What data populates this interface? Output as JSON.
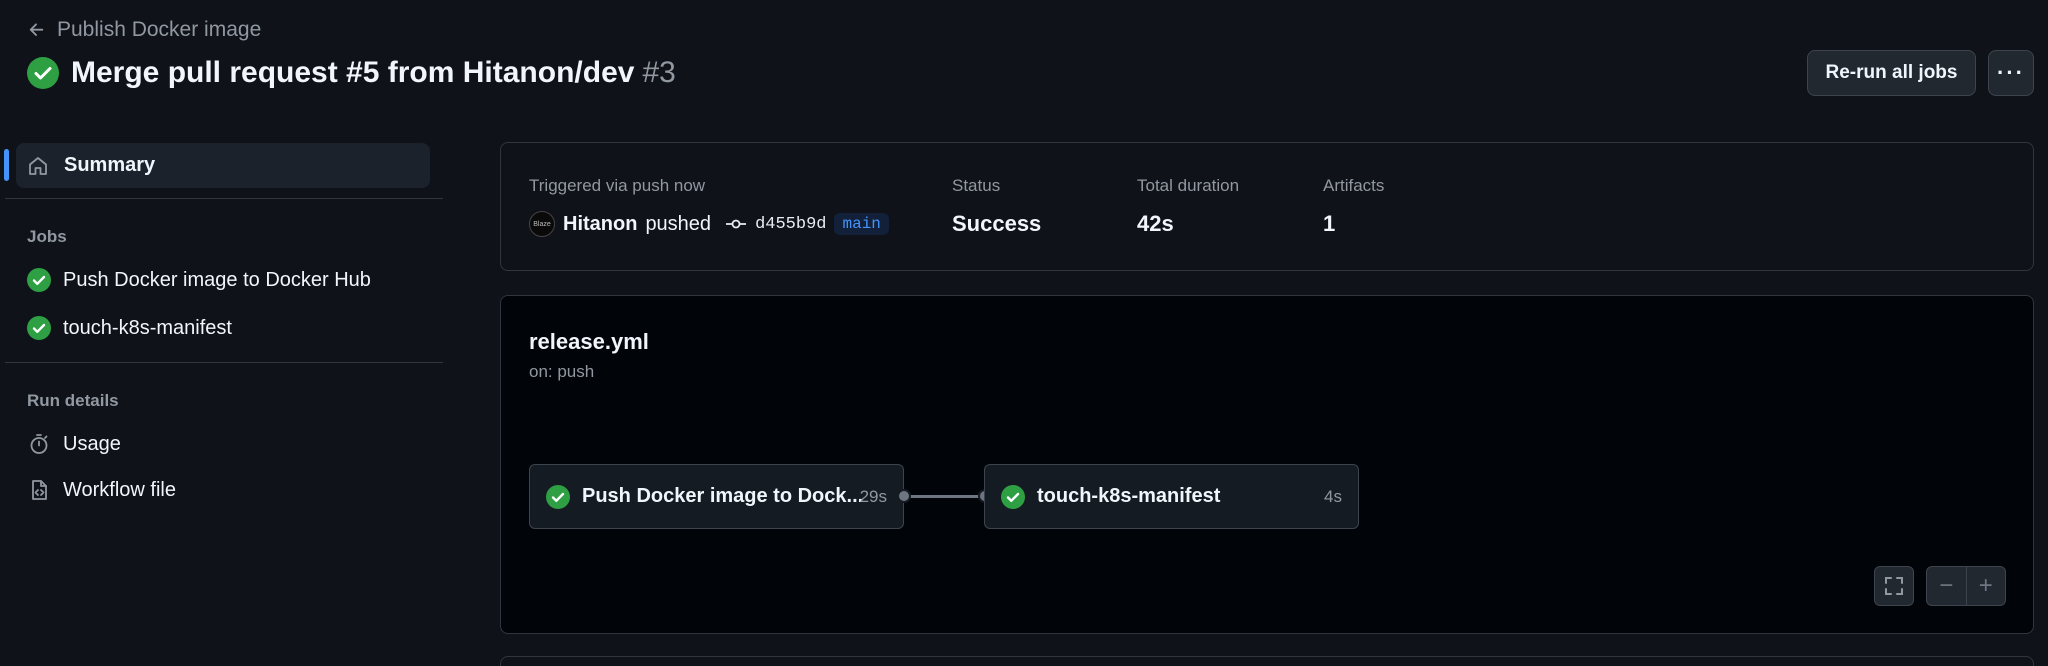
{
  "header": {
    "back_label": "Publish Docker image",
    "title": "Merge pull request #5 from Hitanon/dev",
    "run_number": "#3",
    "rerun_label": "Re-run all jobs",
    "more_label": "···"
  },
  "sidebar": {
    "summary_label": "Summary",
    "jobs_heading": "Jobs",
    "jobs": [
      {
        "label": "Push Docker image to Docker Hub",
        "status": "success"
      },
      {
        "label": "touch-k8s-manifest",
        "status": "success"
      }
    ],
    "run_details_heading": "Run details",
    "details": [
      {
        "label": "Usage",
        "icon": "stopwatch-icon"
      },
      {
        "label": "Workflow file",
        "icon": "file-code-icon"
      }
    ]
  },
  "summary": {
    "trigger_label": "Triggered via push now",
    "actor": "Hitanon",
    "action": "pushed",
    "commit": "d455b9d",
    "branch": "main",
    "avatar_text": "Blaze",
    "status_label": "Status",
    "status_value": "Success",
    "duration_label": "Total duration",
    "duration_value": "42s",
    "artifacts_label": "Artifacts",
    "artifacts_value": "1"
  },
  "workflow": {
    "file": "release.yml",
    "trigger": "on: push",
    "jobs": [
      {
        "name": "Push Docker image to Dock...",
        "duration": "29s",
        "status": "success"
      },
      {
        "name": "touch-k8s-manifest",
        "duration": "4s",
        "status": "success"
      }
    ],
    "controls": {
      "fullscreen_icon": "fullscreen-icon",
      "zoom_out": "−",
      "zoom_in": "+"
    }
  },
  "colors": {
    "success": "#2ea043",
    "accent": "#4493f8",
    "background": "#0f1219"
  }
}
